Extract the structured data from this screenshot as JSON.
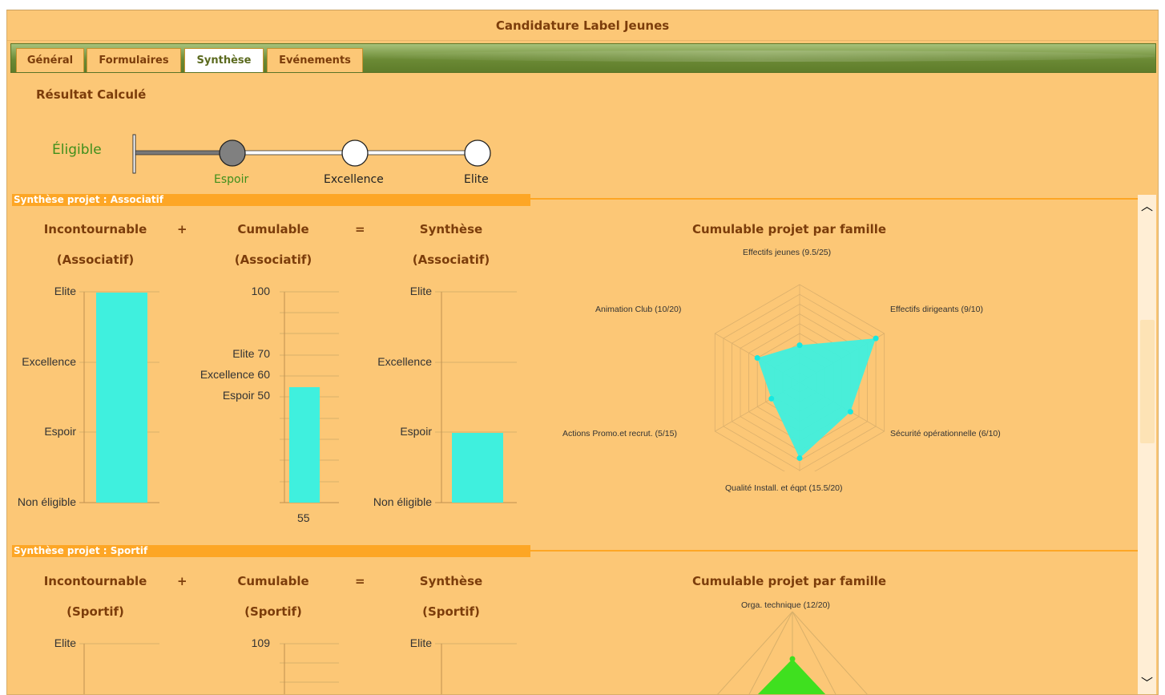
{
  "window": {
    "title": "Candidature Label Jeunes"
  },
  "tabs": [
    {
      "label": "Général",
      "active": false
    },
    {
      "label": "Formulaires",
      "active": false
    },
    {
      "label": "Synthèse",
      "active": true
    },
    {
      "label": "Evénements",
      "active": false
    }
  ],
  "resultat": {
    "title": "Résultat Calculé",
    "status": "Éligible",
    "current_level": "Espoir",
    "levels": [
      "Espoir",
      "Excellence",
      "Elite"
    ]
  },
  "sections": [
    {
      "header": "Synthèse projet : Associatif",
      "operator_plus": "+",
      "operator_equals": "=",
      "incontournable": {
        "title": "Incontournable",
        "subtitle": "(Associatif)",
        "levels": [
          "Elite",
          "Excellence",
          "Espoir",
          "Non éligible"
        ],
        "value": "Elite"
      },
      "cumulable": {
        "title": "Cumulable",
        "subtitle": "(Associatif)",
        "ylim": [
          0,
          100
        ],
        "top_label": "100",
        "thresholds": [
          {
            "label": "Elite 70",
            "value": 70
          },
          {
            "label": "Excellence 60",
            "value": 60
          },
          {
            "label": "Espoir 50",
            "value": 50
          }
        ],
        "value": 55,
        "value_label": "55"
      },
      "synthese": {
        "title": "Synthèse",
        "subtitle": "(Associatif)",
        "levels": [
          "Elite",
          "Excellence",
          "Espoir",
          "Non éligible"
        ],
        "value": "Espoir"
      },
      "radar": {
        "title": "Cumulable projet par famille",
        "axes": [
          {
            "label": "Effectifs jeunes (9.5/25)",
            "value": 9.5,
            "max": 25
          },
          {
            "label": "Effectifs dirigeants (9/10)",
            "value": 9,
            "max": 10
          },
          {
            "label": "Sécurité opérationnelle (6/10)",
            "value": 6,
            "max": 10
          },
          {
            "label": "Qualité Install. et éqpt (15.5/20)",
            "value": 15.5,
            "max": 20
          },
          {
            "label": "Actions Promo.et recrut. (5/15)",
            "value": 5,
            "max": 15
          },
          {
            "label": "Animation Club (10/20)",
            "value": 10,
            "max": 20
          }
        ],
        "fill": "#3ff0de",
        "point": "#17e8e0"
      }
    },
    {
      "header": "Synthèse projet : Sportif",
      "operator_plus": "+",
      "operator_equals": "=",
      "incontournable": {
        "title": "Incontournable",
        "subtitle": "(Sportif)",
        "levels": [
          "Elite"
        ]
      },
      "cumulable": {
        "title": "Cumulable",
        "subtitle": "(Sportif)",
        "top_label": "109"
      },
      "synthese": {
        "title": "Synthèse",
        "subtitle": "(Sportif)",
        "levels": [
          "Elite"
        ]
      },
      "radar": {
        "title": "Cumulable projet par famille",
        "axes": [
          {
            "label": "Orga. technique (12/20)",
            "value": 12,
            "max": 20
          }
        ],
        "fill": "#3fe01f"
      }
    }
  ],
  "colors": {
    "bar": "#3ff0de",
    "header": "#fda625",
    "panel": "#fcc776",
    "title_text": "#7c3d0b",
    "eligible": "#3f8f1c"
  }
}
